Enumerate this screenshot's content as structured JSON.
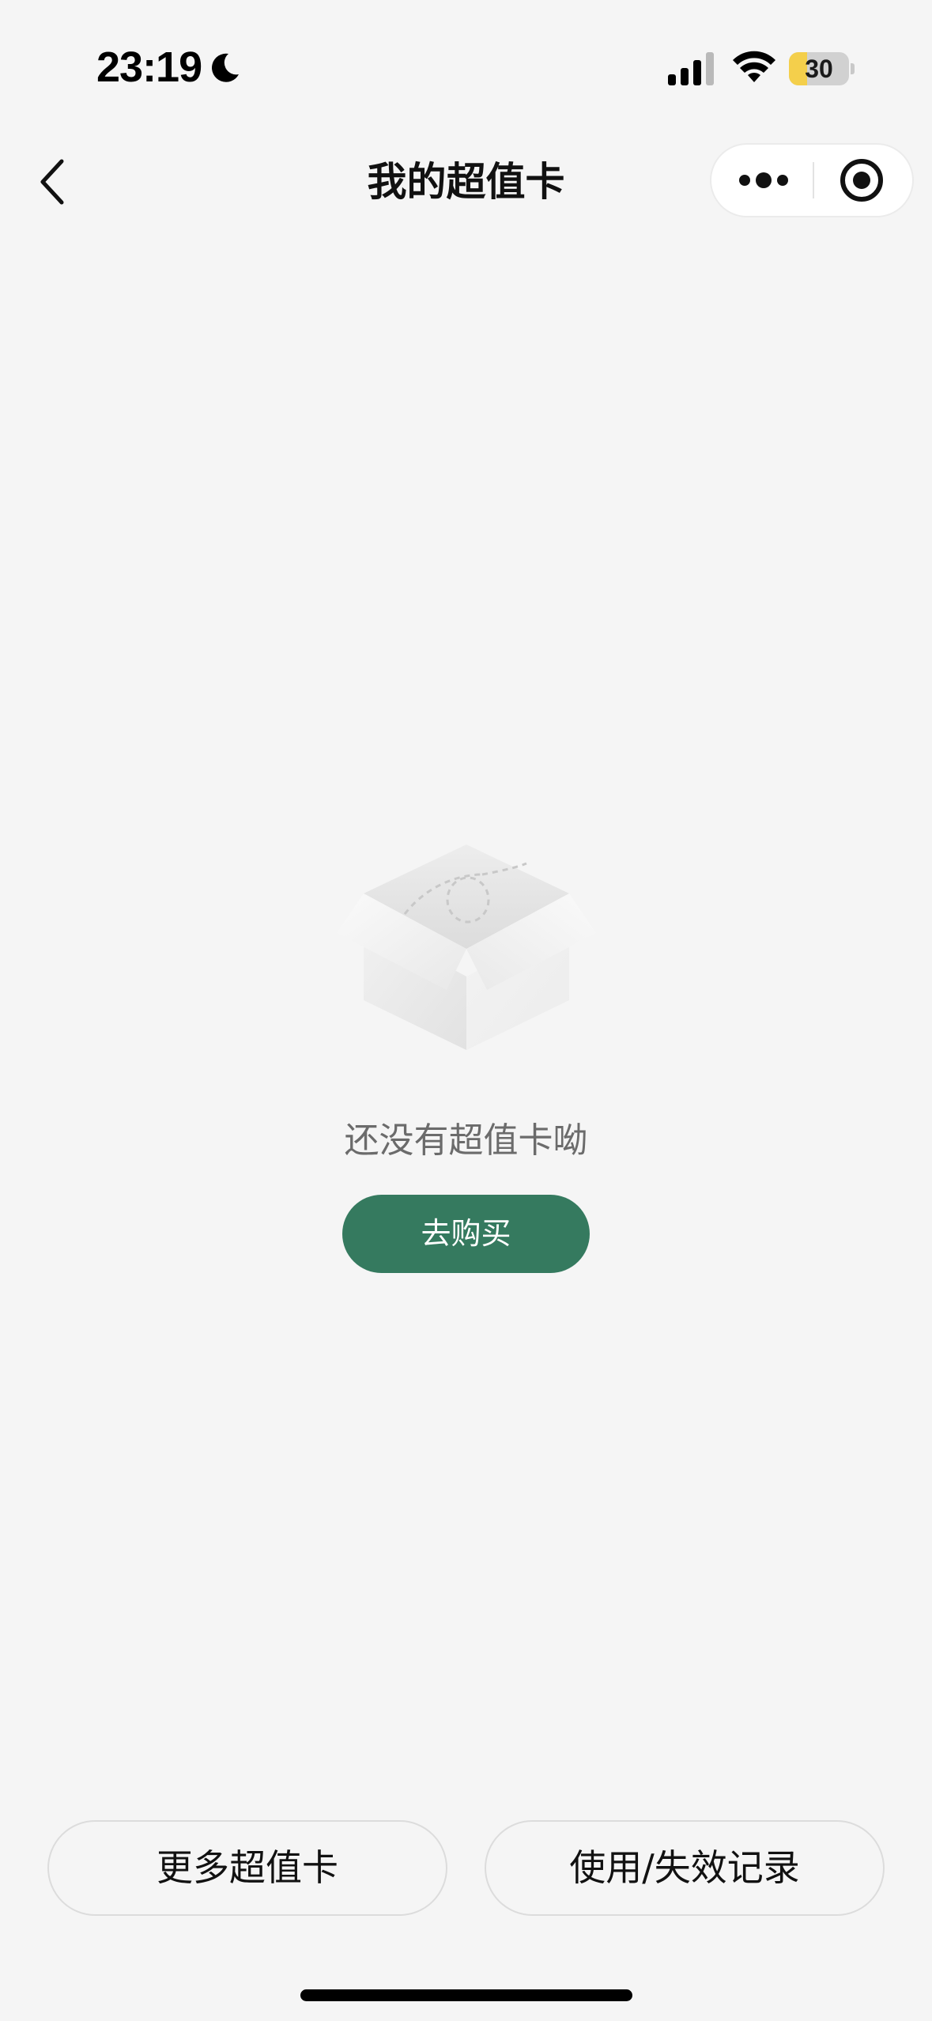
{
  "status_bar": {
    "time": "23:19",
    "battery": "30",
    "battery_level": 0.3,
    "icons": [
      "moon-icon",
      "signal-icon",
      "wifi-icon",
      "battery-icon"
    ]
  },
  "nav": {
    "title": "我的超值卡",
    "icons": [
      "chevron-left-icon",
      "more-icon",
      "close-target-icon"
    ]
  },
  "empty_state": {
    "icon": "empty-box-icon",
    "message": "还没有超值卡呦",
    "button_label": "去购买"
  },
  "bottom": {
    "more_cards_label": "更多超值卡",
    "records_label": "使用/失效记录"
  },
  "colors": {
    "background": "#f5f5f5",
    "accent": "#357a5f",
    "battery_low": "#f4cf4b"
  }
}
